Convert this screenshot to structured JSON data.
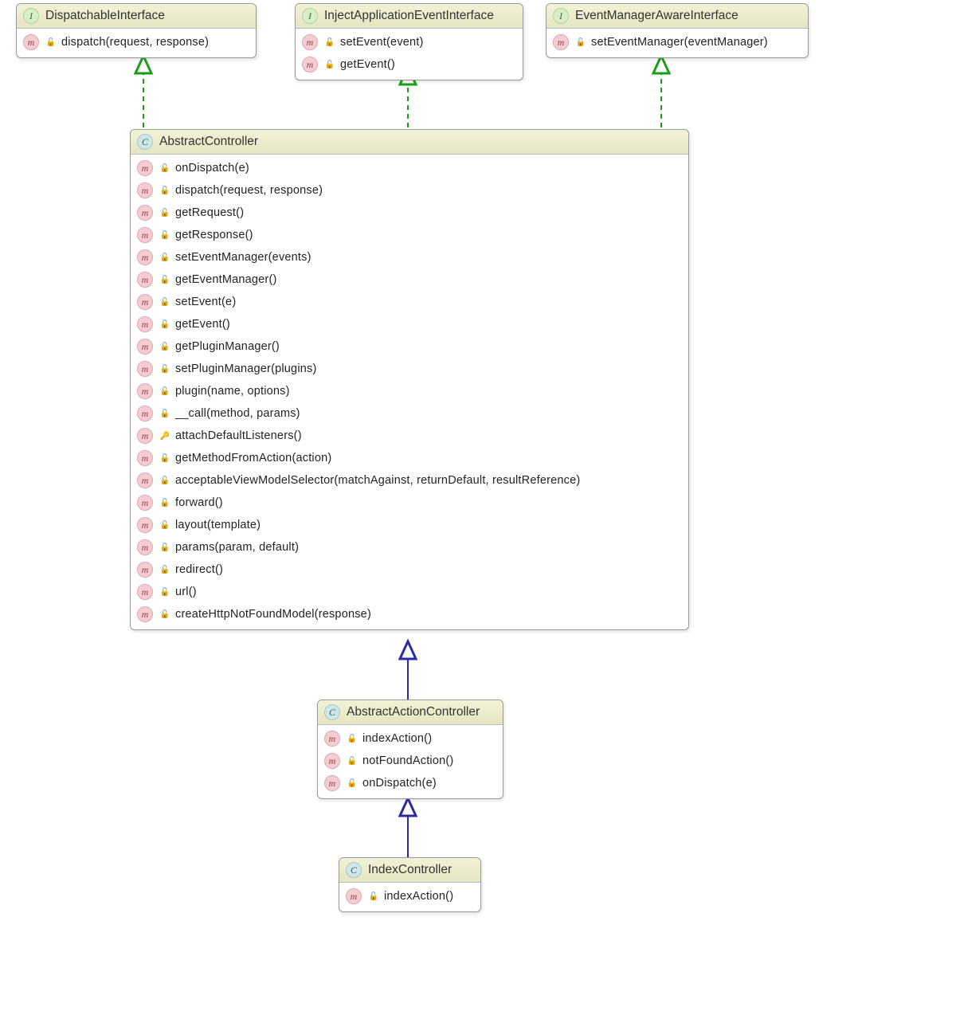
{
  "interfaces": {
    "dispatchable": {
      "name": "DispatchableInterface",
      "members": [
        {
          "label": "dispatch(request, response)",
          "vis": "public"
        }
      ]
    },
    "injectApp": {
      "name": "InjectApplicationEventInterface",
      "members": [
        {
          "label": "setEvent(event)",
          "vis": "public"
        },
        {
          "label": "getEvent()",
          "vis": "public"
        }
      ]
    },
    "eventMgrAware": {
      "name": "EventManagerAwareInterface",
      "members": [
        {
          "label": "setEventManager(eventManager)",
          "vis": "public"
        }
      ]
    }
  },
  "classes": {
    "abstractController": {
      "name": "AbstractController",
      "members": [
        {
          "label": "onDispatch(e)",
          "vis": "public"
        },
        {
          "label": "dispatch(request, response)",
          "vis": "public"
        },
        {
          "label": "getRequest()",
          "vis": "public"
        },
        {
          "label": "getResponse()",
          "vis": "public"
        },
        {
          "label": "setEventManager(events)",
          "vis": "public"
        },
        {
          "label": "getEventManager()",
          "vis": "public"
        },
        {
          "label": "setEvent(e)",
          "vis": "public"
        },
        {
          "label": "getEvent()",
          "vis": "public"
        },
        {
          "label": "getPluginManager()",
          "vis": "public"
        },
        {
          "label": "setPluginManager(plugins)",
          "vis": "public"
        },
        {
          "label": "plugin(name, options)",
          "vis": "public"
        },
        {
          "label": "__call(method, params)",
          "vis": "public"
        },
        {
          "label": "attachDefaultListeners()",
          "vis": "protected"
        },
        {
          "label": "getMethodFromAction(action)",
          "vis": "public"
        },
        {
          "label": "acceptableViewModelSelector(matchAgainst, returnDefault, resultReference)",
          "vis": "public"
        },
        {
          "label": "forward()",
          "vis": "public"
        },
        {
          "label": "layout(template)",
          "vis": "public"
        },
        {
          "label": "params(param, default)",
          "vis": "public"
        },
        {
          "label": "redirect()",
          "vis": "public"
        },
        {
          "label": "url()",
          "vis": "public"
        },
        {
          "label": "createHttpNotFoundModel(response)",
          "vis": "public"
        }
      ]
    },
    "abstractAction": {
      "name": "AbstractActionController",
      "members": [
        {
          "label": "indexAction()",
          "vis": "public"
        },
        {
          "label": "notFoundAction()",
          "vis": "public"
        },
        {
          "label": "onDispatch(e)",
          "vis": "public"
        }
      ]
    },
    "index": {
      "name": "IndexController",
      "members": [
        {
          "label": "indexAction()",
          "vis": "public"
        }
      ]
    }
  },
  "relations": [
    {
      "from": "abstractController",
      "to": "dispatchable",
      "kind": "implements"
    },
    {
      "from": "abstractController",
      "to": "injectApp",
      "kind": "implements"
    },
    {
      "from": "abstractController",
      "to": "eventMgrAware",
      "kind": "implements"
    },
    {
      "from": "abstractAction",
      "to": "abstractController",
      "kind": "extends"
    },
    {
      "from": "index",
      "to": "abstractAction",
      "kind": "extends"
    }
  ]
}
